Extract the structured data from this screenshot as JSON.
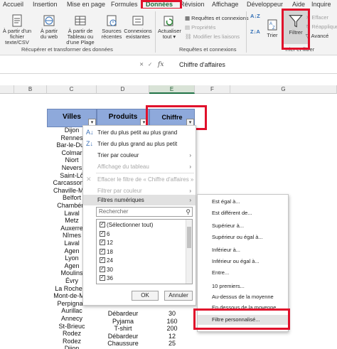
{
  "ribbon_tabs": [
    "Accueil",
    "Insertion",
    "Mise en page",
    "Formules",
    "Données",
    "Révision",
    "Affichage",
    "Développeur",
    "Aide",
    "Inquire"
  ],
  "ribbon": {
    "get_transform": {
      "buttons": [
        "À partir d'un fichier texte/CSV",
        "À partir du web",
        "À partir de Tableau ou d'une Plage",
        "Sources récentes",
        "Connexions existantes"
      ],
      "group_label": "Récupérer et transformer des données"
    },
    "queries": {
      "refresh_label": "Actualiser tout",
      "refresh_arrow": "▾",
      "items": [
        "Requêtes et connexions",
        "Propriétés",
        "Modifier les liaisons"
      ],
      "group_label": "Requêtes et connexions"
    },
    "sort_filter": {
      "sort_label": "Trier",
      "filter_label": "Filtrer",
      "effacer": "Effacer",
      "reappliquer": "Réappliquer",
      "avance": "Avancé",
      "group_label": "Trier et filtrer"
    }
  },
  "formula_bar": {
    "fx": "fx",
    "value": "Chiffre d'affaires"
  },
  "columns": [
    "B",
    "C",
    "D",
    "E",
    "F",
    "G"
  ],
  "table": {
    "headers": [
      "Villes",
      "Produits",
      "Chiffre d'affaires"
    ],
    "villes": [
      "Dijon",
      "Rennes",
      "Bar-le-Duc",
      "Colmar",
      "Niort",
      "Nevers",
      "Saint-Lô",
      "Carcassonne",
      "Chaville-Méz",
      "Belfort",
      "Chambéry",
      "Laval",
      "Metz",
      "Auxerre",
      "Nîmes",
      "Laval",
      "Agen",
      "Lyon",
      "Agen",
      "Moulins",
      "Évry",
      "La Rochelle",
      "Mont-de-Mar",
      "Perpignan",
      "Aurillac",
      "Annecy",
      "St-Brieuc",
      "Rodez",
      "Rodez",
      "Dijon"
    ],
    "bottom_rows": [
      {
        "produit": "Débardeur",
        "ca": "30"
      },
      {
        "produit": "Pyjama",
        "ca": "160"
      },
      {
        "produit": "T-shirt",
        "ca": "200"
      },
      {
        "produit": "Débardeur",
        "ca": "12"
      },
      {
        "produit": "Chaussure",
        "ca": "25"
      }
    ]
  },
  "dropdown": {
    "items": [
      "Trier du plus petit au plus grand",
      "Trier du plus grand au plus petit",
      "Trier par couleur",
      "Affichage du tableau",
      "Effacer le filtre de « Chiffre d'affaires »",
      "Filtrer par couleur",
      "Filtres numériques"
    ],
    "search_placeholder": "Rechercher",
    "values": [
      "(Sélectionner tout)",
      "6",
      "12",
      "18",
      "24",
      "30",
      "36"
    ],
    "ok": "OK",
    "cancel": "Annuler"
  },
  "submenu": [
    "Est égal à...",
    "Est différent de...",
    "Supérieur à...",
    "Supérieur ou égal à...",
    "Inférieur à...",
    "Inférieur ou égal à...",
    "Entre...",
    "10 premiers...",
    "Au-dessus de la moyenne",
    "En dessous de la moyenne",
    "Filtre personnalisé..."
  ]
}
